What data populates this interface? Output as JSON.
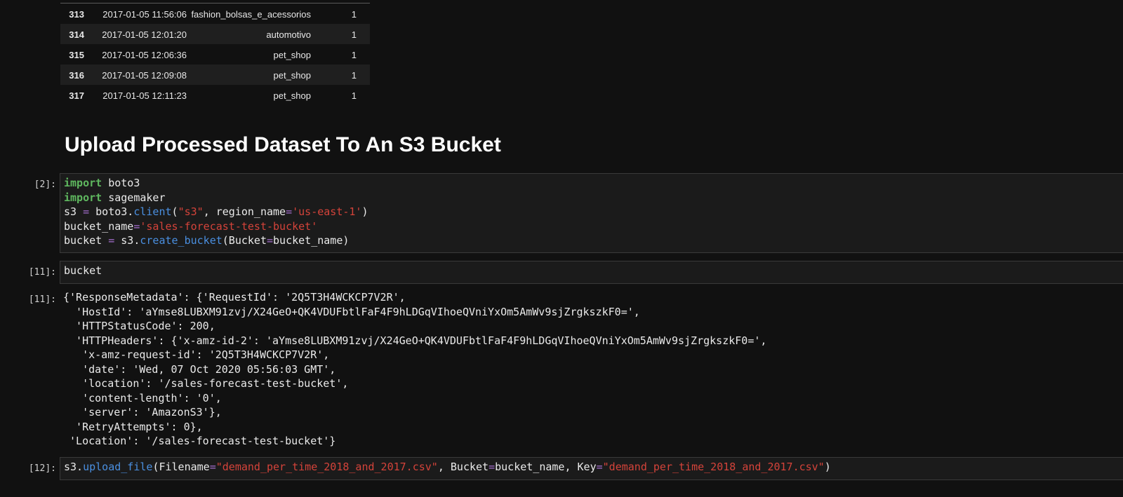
{
  "dataframe": {
    "rows": [
      {
        "index": "313",
        "date": "2017-01-05 11:56:06",
        "category": "fashion_bolsas_e_acessorios",
        "count": "1"
      },
      {
        "index": "314",
        "date": "2017-01-05 12:01:20",
        "category": "automotivo",
        "count": "1"
      },
      {
        "index": "315",
        "date": "2017-01-05 12:06:36",
        "category": "pet_shop",
        "count": "1"
      },
      {
        "index": "316",
        "date": "2017-01-05 12:09:08",
        "category": "pet_shop",
        "count": "1"
      },
      {
        "index": "317",
        "date": "2017-01-05 12:11:23",
        "category": "pet_shop",
        "count": "1"
      }
    ]
  },
  "markdown": {
    "heading": "Upload Processed Dataset To An S3 Bucket"
  },
  "cells": [
    {
      "prompt": "[2]:",
      "lines": [
        [
          {
            "k": "kw",
            "t": "import"
          },
          {
            "k": "",
            "t": " boto3"
          }
        ],
        [
          {
            "k": "kw",
            "t": "import"
          },
          {
            "k": "",
            "t": " sagemaker"
          }
        ],
        [
          {
            "k": "",
            "t": "s3 "
          },
          {
            "k": "eq",
            "t": "="
          },
          {
            "k": "",
            "t": " boto3."
          },
          {
            "k": "fn",
            "t": "client"
          },
          {
            "k": "",
            "t": "("
          },
          {
            "k": "st",
            "t": "\"s3\""
          },
          {
            "k": "",
            "t": ", region_name"
          },
          {
            "k": "eq",
            "t": "="
          },
          {
            "k": "st",
            "t": "'us-east-1'"
          },
          {
            "k": "",
            "t": ")"
          }
        ],
        [
          {
            "k": "",
            "t": "bucket_name"
          },
          {
            "k": "eq",
            "t": "="
          },
          {
            "k": "st",
            "t": "'sales-forecast-test-bucket'"
          }
        ],
        [
          {
            "k": "",
            "t": "bucket "
          },
          {
            "k": "eq",
            "t": "="
          },
          {
            "k": "",
            "t": " s3."
          },
          {
            "k": "fn",
            "t": "create_bucket"
          },
          {
            "k": "",
            "t": "(Bucket"
          },
          {
            "k": "eq",
            "t": "="
          },
          {
            "k": "",
            "t": "bucket_name)"
          }
        ]
      ]
    },
    {
      "prompt": "[11]:",
      "lines": [
        [
          {
            "k": "",
            "t": "bucket"
          }
        ]
      ]
    },
    {
      "prompt": "[12]:",
      "lines": [
        [
          {
            "k": "",
            "t": "s3."
          },
          {
            "k": "fn",
            "t": "upload_file"
          },
          {
            "k": "",
            "t": "(Filename"
          },
          {
            "k": "eq",
            "t": "="
          },
          {
            "k": "st",
            "t": "\"demand_per_time_2018_and_2017.csv\""
          },
          {
            "k": "",
            "t": ", Bucket"
          },
          {
            "k": "eq",
            "t": "="
          },
          {
            "k": "",
            "t": "bucket_name, Key"
          },
          {
            "k": "eq",
            "t": "="
          },
          {
            "k": "st",
            "t": "\"demand_per_time_2018_and_2017.csv\""
          },
          {
            "k": "",
            "t": ")"
          }
        ]
      ]
    }
  ],
  "output": {
    "prompt": "[11]:",
    "text": "{'ResponseMetadata': {'RequestId': '2Q5T3H4WCKCP7V2R',\n  'HostId': 'aYmse8LUBXM91zvj/X24GeO+QK4VDUFbtlFaF4F9hLDGqVIhoeQVniYxOm5AmWv9sjZrgkszkF0=',\n  'HTTPStatusCode': 200,\n  'HTTPHeaders': {'x-amz-id-2': 'aYmse8LUBXM91zvj/X24GeO+QK4VDUFbtlFaF4F9hLDGqVIhoeQVniYxOm5AmWv9sjZrgkszkF0=',\n   'x-amz-request-id': '2Q5T3H4WCKCP7V2R',\n   'date': 'Wed, 07 Oct 2020 05:56:03 GMT',\n   'location': '/sales-forecast-test-bucket',\n   'content-length': '0',\n   'server': 'AmazonS3'},\n  'RetryAttempts': 0},\n 'Location': '/sales-forecast-test-bucket'}"
  },
  "colors": {
    "background": "#111111",
    "keyword": "#5fb85f",
    "function": "#4a8fe0",
    "string": "#d4433a",
    "operator": "#a66fd0"
  }
}
